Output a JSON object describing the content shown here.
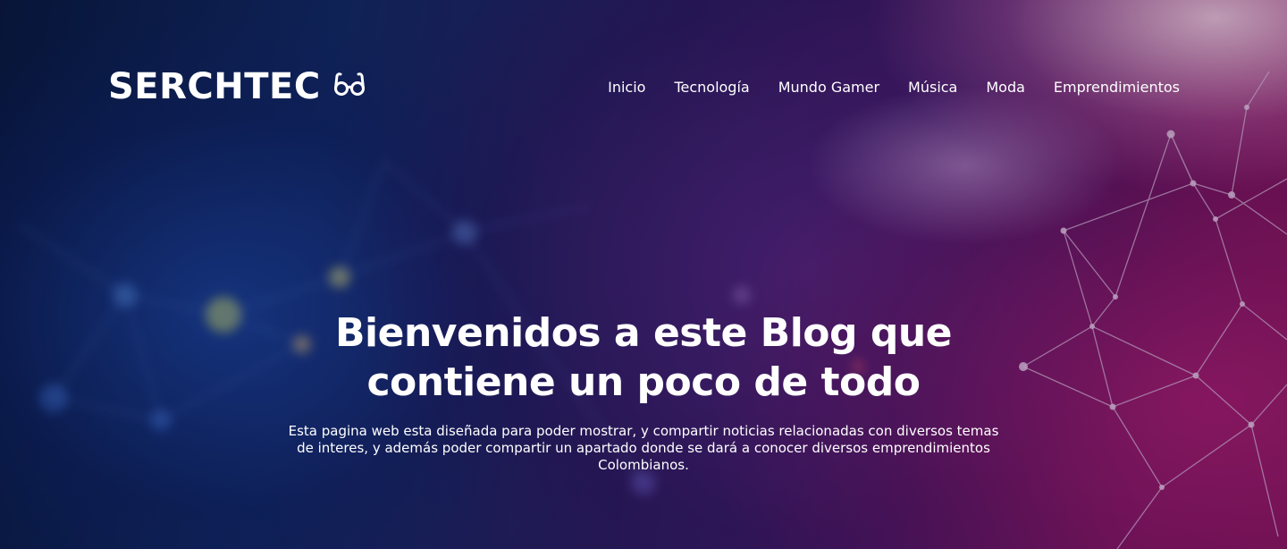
{
  "brand": {
    "name": "SERCHTEC",
    "icon": "glasses-icon"
  },
  "nav": {
    "items": [
      "Inicio",
      "Tecnología",
      "Mundo Gamer",
      "Música",
      "Moda",
      "Emprendimientos"
    ]
  },
  "hero": {
    "title": "Bienvenidos a este Blog que contiene un poco de todo",
    "subtitle": "Esta pagina web esta diseñada para poder mostrar, y compartir noticias relacionadas con diversos temas de interes, y además poder compartir un apartado donde se dará a conocer diversos emprendimientos Colombianos.",
    "background": "network-nodes-image"
  },
  "colors": {
    "text": "#ffffff",
    "bg_blue": "#132a6a",
    "bg_purple": "#4a1a6e",
    "bg_magenta": "#8a1460"
  }
}
